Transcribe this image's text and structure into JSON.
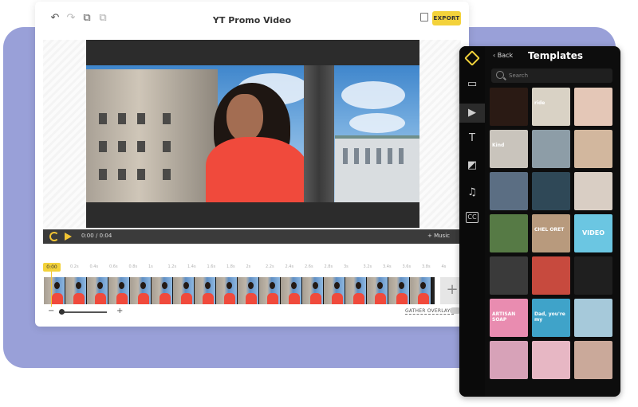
{
  "window": {
    "title": "YT Promo Video"
  },
  "toolbar": {
    "export_label": "EXPORT",
    "icons": [
      "undo-icon",
      "redo-icon",
      "copy-icon",
      "paste-icon",
      "save-icon"
    ]
  },
  "player": {
    "time_current": "0:00",
    "time_separator": "/",
    "time_total": "0:04",
    "music_label": "+ Music"
  },
  "timeline": {
    "playhead_label": "0:00",
    "ticks": [
      "0.2s",
      "0.4s",
      "0.6s",
      "0.8s",
      "1s",
      "1.2s",
      "1.4s",
      "1.6s",
      "1.8s",
      "2s",
      "2.2s",
      "2.4s",
      "2.6s",
      "2.8s",
      "3s",
      "3.2s",
      "3.4s",
      "3.6s",
      "3.8s",
      "4s"
    ],
    "add_label": "+",
    "zoom_minus": "−",
    "zoom_plus": "+",
    "gather_overlays_label": "GATHER OVERLAYS"
  },
  "panel": {
    "back_label": "‹ Back",
    "title": "Templates",
    "search_placeholder": "Search",
    "rail_icons": [
      "folder-upload-icon",
      "video-templates-icon",
      "text-icon",
      "shapes-icon",
      "music-icon",
      "captions-icon"
    ],
    "tiles": [
      {
        "caption": "",
        "color": "#2a1a14"
      },
      {
        "caption": "ride",
        "color": "#d9d2c5"
      },
      {
        "caption": "",
        "color": "#e4c7b7"
      },
      {
        "caption": "Kind",
        "color": "#c9c4bc"
      },
      {
        "caption": "",
        "color": "#8d9da7"
      },
      {
        "caption": "",
        "color": "#d2b79e"
      },
      {
        "caption": "",
        "color": "#5b6e83"
      },
      {
        "caption": "",
        "color": "#2f4857"
      },
      {
        "caption": "",
        "color": "#d9cec4"
      },
      {
        "caption": "",
        "color": "#567a45"
      },
      {
        "caption": "CHEL ORET",
        "color": "#b89a7d"
      },
      {
        "caption": "VIDEO",
        "color": "#6bc6e2"
      },
      {
        "caption": "",
        "color": "#3a3a3a"
      },
      {
        "caption": "",
        "color": "#c74a3e"
      },
      {
        "caption": "",
        "color": "#1f1f1f"
      },
      {
        "caption": "ARTISAN SOAP",
        "color": "#e98cb0"
      },
      {
        "caption": "Dad, you're my",
        "color": "#3fa3c9"
      },
      {
        "caption": "",
        "color": "#a6c9da"
      },
      {
        "caption": "",
        "color": "#d7a2b8"
      },
      {
        "caption": "",
        "color": "#e7b7c4"
      },
      {
        "caption": "",
        "color": "#caa99a"
      }
    ]
  }
}
